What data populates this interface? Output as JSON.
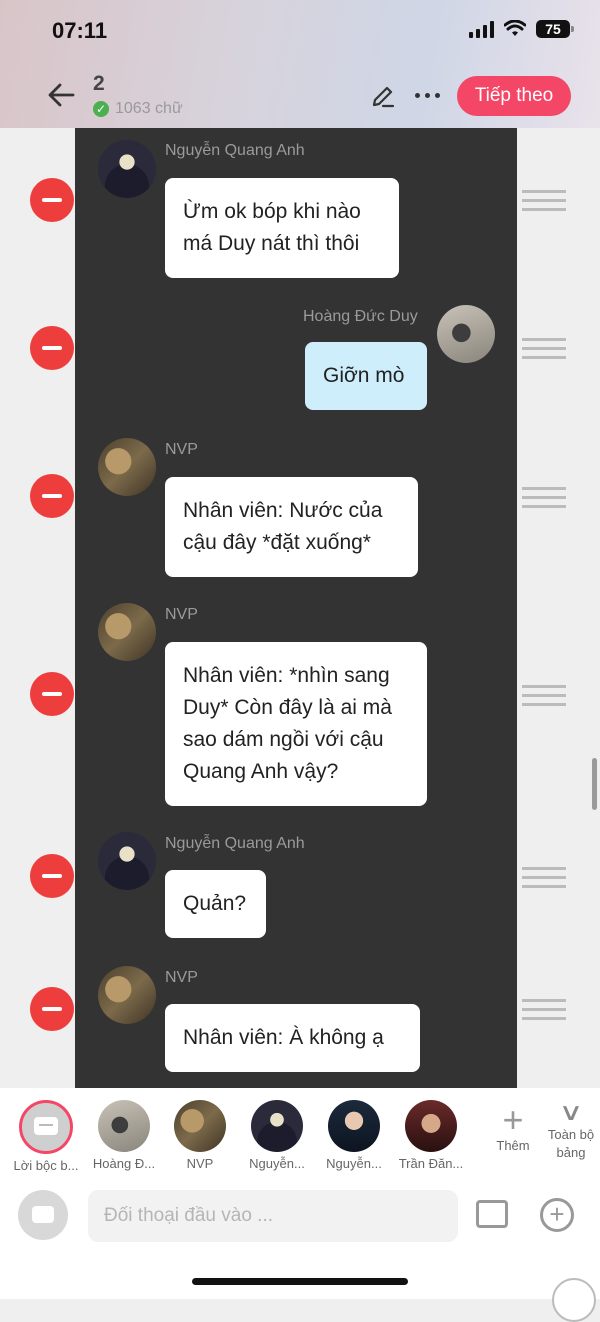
{
  "status": {
    "time": "07:11",
    "battery": "75"
  },
  "header": {
    "chapter": "2",
    "word_count": "1063 chữ",
    "next_label": "Tiếp theo"
  },
  "messages": [
    {
      "speaker": "Nguyễn Quang Anh",
      "text": "Ừm ok bóp khi nào má Duy nát thì thôi",
      "side": "left"
    },
    {
      "speaker": "Hoàng Đức Duy",
      "text": "Giỡn mò",
      "side": "right"
    },
    {
      "speaker": "NVP",
      "text": "Nhân viên: Nước của cậu đây *đặt xuống*",
      "side": "left"
    },
    {
      "speaker": "NVP",
      "text": "Nhân viên: *nhìn sang Duy* Còn đây là ai mà sao dám ngồi với cậu Quang Anh vậy?",
      "side": "left"
    },
    {
      "speaker": "Nguyễn Quang Anh",
      "text": "Quản?",
      "side": "left"
    },
    {
      "speaker": "NVP",
      "text": "Nhân viên: À không ạ",
      "side": "left"
    }
  ],
  "characters": [
    {
      "label": "Lời bộc b..."
    },
    {
      "label": "Hoàng Đ..."
    },
    {
      "label": "NVP"
    },
    {
      "label": "Nguyễn..."
    },
    {
      "label": "Nguyễn..."
    },
    {
      "label": "Trần Đăn..."
    }
  ],
  "add_character_label": "Thêm",
  "full_board_label": "Toàn bộ bảng",
  "input": {
    "placeholder": "Đối thoại đầu vào ..."
  }
}
